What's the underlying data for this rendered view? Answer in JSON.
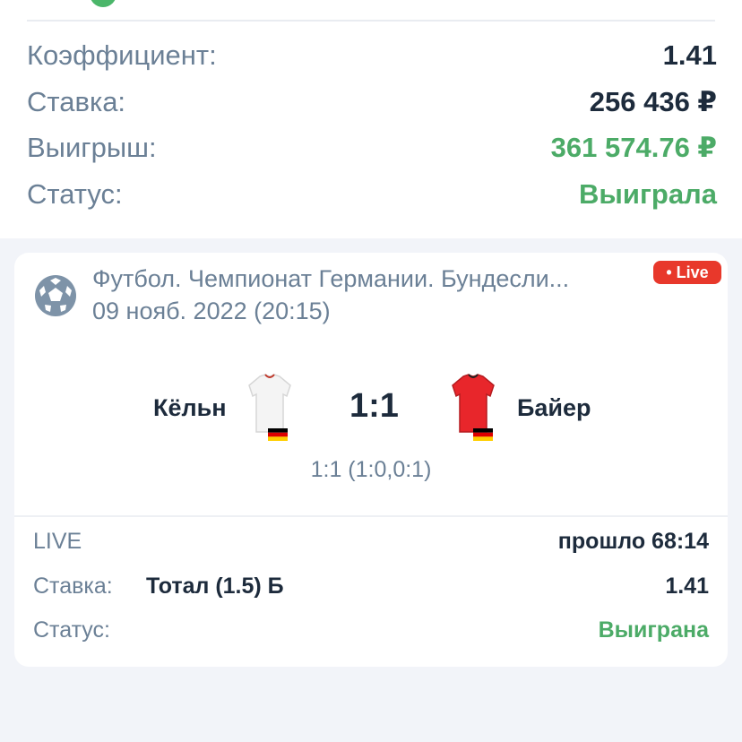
{
  "summary": {
    "coef_label": "Коэффициент:",
    "coef_value": "1.41",
    "stake_label": "Ставка:",
    "stake_value": "256 436 ₽",
    "win_label": "Выигрыш:",
    "win_value": "361 574.76 ₽",
    "status_label": "Статус:",
    "status_value": "Выиграла"
  },
  "event": {
    "sport_icon": "soccer-ball-icon",
    "league": "Футбол. Чемпионат Германии. Бундесли...",
    "date": "09 нояб. 2022 (20:15)",
    "live_badge": "• Live",
    "home_team": "Кёльн",
    "away_team": "Байер",
    "score": "1:1",
    "subscore": "1:1 (1:0,0:1)"
  },
  "bet": {
    "mode": "LIVE",
    "elapsed": "прошло 68:14",
    "stake_label": "Ставка:",
    "selection": "Тотал (1.5) Б",
    "odds": "1.41",
    "status_label": "Статус:",
    "status_value": "Выиграна"
  },
  "colors": {
    "accent_green": "#4cab67",
    "live_red": "#e8382b",
    "muted_text": "#6b8096",
    "dark_text": "#1d2b3c",
    "background": "#f2f4f9"
  }
}
